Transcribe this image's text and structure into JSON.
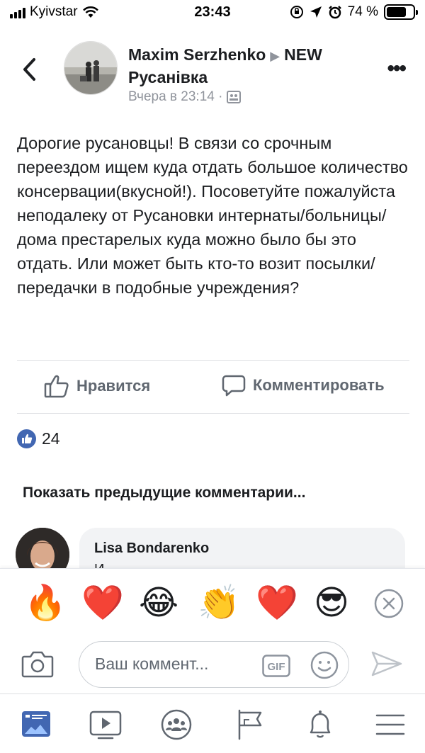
{
  "status_bar": {
    "carrier": "Kyivstar",
    "time": "23:43",
    "battery": "74 %",
    "battery_level": 0.74
  },
  "post": {
    "author": "Maxim Serzhenko",
    "group_name_line1": "NEW",
    "group_name_line2": "Русанівка",
    "timestamp": "Вчера в 23:14 ·",
    "body": "Дорогие русановцы! В связи со срочным переездом ищем куда отдать большое количество консервации(вкусной!). Посоветуйте пожалуйста неподалеку от Русановки интернаты/больницы/дома престарелых куда можно было бы это отдать. Или может быть кто-то возит посылки/передачки в подобные учреждения?"
  },
  "actions": {
    "like_label": "Нравится",
    "comment_label": "Комментировать"
  },
  "reactions": {
    "count": "24"
  },
  "comments": {
    "show_previous_label": "Показать предыдущие комментарии...",
    "first_author": "Lisa Bondarenko",
    "first_text_visible": "И"
  },
  "emoji_bar": {
    "items": [
      "🔥",
      "❤️",
      "😂",
      "👏",
      "❤️",
      "😎"
    ]
  },
  "composer": {
    "placeholder": "Ваш коммент...",
    "gif_label": "GIF"
  },
  "colors": {
    "facebook_blue": "#4267b2",
    "icon_gray": "#606770",
    "meta_gray": "#90949c",
    "bubble_gray": "#f2f3f5"
  }
}
